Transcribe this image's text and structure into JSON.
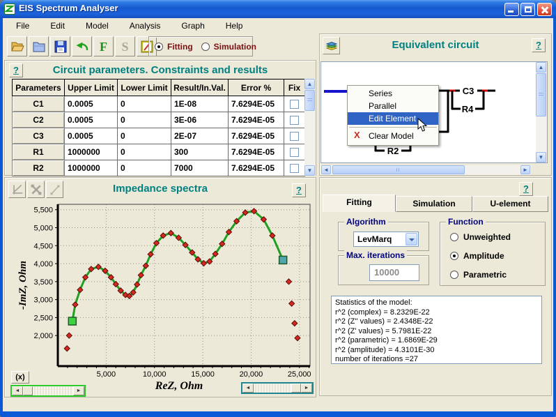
{
  "window": {
    "title": "EIS Spectrum Analyser"
  },
  "menu_bar": {
    "items": [
      "File",
      "Edit",
      "Model",
      "Analysis",
      "Graph",
      "Help"
    ]
  },
  "toolbar": {
    "icons": [
      "open-folder-icon",
      "blue-folder-icon",
      "save-icon",
      "undo-icon",
      "fit-letter",
      "simulate-letter",
      "edit-note-icon"
    ],
    "fit_letter": "F",
    "simulate_letter": "S",
    "mode": {
      "options": [
        "Fitting",
        "Simulation"
      ],
      "selected": "Fitting"
    }
  },
  "ui": {
    "help_label": "?"
  },
  "circuit_params": {
    "title": "Circuit parameters. Constraints and results",
    "table": {
      "headers": [
        "Parameters",
        "Upper Limit",
        "Lower Limit",
        "Result/In.Val.",
        "Error %",
        "Fix"
      ],
      "rows": [
        {
          "parameter": "C1",
          "upper": "0.0005",
          "lower": "0",
          "result": "1E-08",
          "error": "7.6294E-05",
          "fixed": false
        },
        {
          "parameter": "C2",
          "upper": "0.0005",
          "lower": "0",
          "result": "3E-06",
          "error": "7.6294E-05",
          "fixed": false
        },
        {
          "parameter": "C3",
          "upper": "0.0005",
          "lower": "0",
          "result": "2E-07",
          "error": "7.6294E-05",
          "fixed": false
        },
        {
          "parameter": "R1",
          "upper": "1000000",
          "lower": "0",
          "result": "300",
          "error": "7.6294E-05",
          "fixed": false
        },
        {
          "parameter": "R2",
          "upper": "1000000",
          "lower": "0",
          "result": "7000",
          "error": "7.6294E-05",
          "fixed": false
        }
      ]
    }
  },
  "equivalent_circuit": {
    "title": "Equivalent circuit",
    "elements": {
      "c3": "C3",
      "r4": "R4",
      "r2": "R2"
    },
    "context_menu": {
      "items": [
        "Series",
        "Parallel",
        "Edit Element",
        "Clear Model"
      ],
      "highlighted": "Edit Element"
    }
  },
  "impedance": {
    "title": "Impedance spectra",
    "x_button_label": "(x)"
  },
  "fitting_panel": {
    "tabs": [
      "Fitting",
      "Simulation",
      "U-element"
    ],
    "active_tab": "Fitting",
    "algorithm": {
      "label": "Algorithm",
      "value": "LevMarq"
    },
    "max_iterations": {
      "label": "Max. iterations",
      "value": "10000"
    },
    "function_group": {
      "label": "Function",
      "options": [
        "Unweighted",
        "Amplitude",
        "Parametric"
      ],
      "selected": "Amplitude"
    },
    "statistics": {
      "lines": [
        "Statistics of the model:",
        "r^2 (complex) = 8.2329E-22",
        "r^2 (Z'' values) = 2.4348E-22",
        "r^2 (Z' values) = 5.7981E-22",
        "r^2 (parametric) = 1.6869E-29",
        "r^2 (amplitude) = 4.3101E-30",
        "number of iterations =27"
      ]
    }
  },
  "colors": {
    "heading_teal": "#008080",
    "mode_red": "#7A1010",
    "group_navy": "#000080",
    "menu_highlight": "#2F63C4",
    "curve_green": "#1FA020",
    "marker_red": "#D42A1E",
    "start_square_green": "#3FD23F",
    "end_square_teal": "#4FA6AC",
    "slider_green_border": "#2CCB2C",
    "slider_teal_border": "#1E868E"
  },
  "chart_data": {
    "type": "line",
    "title": "Impedance spectra",
    "xlabel": "ReZ, Ohm",
    "ylabel": "-ImZ, Ohm",
    "xlim": [
      0,
      26100
    ],
    "ylim": [
      1150,
      5650
    ],
    "x_ticks": [
      5000,
      10000,
      15000,
      20000,
      25000
    ],
    "x_tick_labels": [
      "5,000",
      "10,000",
      "15,000",
      "20,000",
      "25,000"
    ],
    "y_ticks": [
      2000,
      2500,
      3000,
      3500,
      4000,
      4500,
      5000,
      5500
    ],
    "y_tick_labels": [
      "2,000",
      "2,500",
      "3,000",
      "3,500",
      "4,000",
      "4,500",
      "5,000",
      "5,500"
    ],
    "grid": true,
    "legend": "none",
    "series": [
      {
        "name": "fitted-curve",
        "type": "line",
        "color": "#1FA020",
        "points": [
          [
            1500,
            2400
          ],
          [
            1800,
            2860
          ],
          [
            2300,
            3270
          ],
          [
            2850,
            3620
          ],
          [
            3450,
            3850
          ],
          [
            4200,
            3910
          ],
          [
            4900,
            3800
          ],
          [
            5500,
            3620
          ],
          [
            6000,
            3430
          ],
          [
            6500,
            3250
          ],
          [
            7000,
            3130
          ],
          [
            7400,
            3100
          ],
          [
            7800,
            3200
          ],
          [
            8200,
            3420
          ],
          [
            8600,
            3680
          ],
          [
            9100,
            3940
          ],
          [
            9600,
            4260
          ],
          [
            10200,
            4570
          ],
          [
            10900,
            4780
          ],
          [
            11700,
            4850
          ],
          [
            12500,
            4720
          ],
          [
            13200,
            4520
          ],
          [
            13900,
            4310
          ],
          [
            14500,
            4120
          ],
          [
            15100,
            4010
          ],
          [
            15700,
            4060
          ],
          [
            16300,
            4270
          ],
          [
            17000,
            4550
          ],
          [
            17700,
            4880
          ],
          [
            18500,
            5180
          ],
          [
            19400,
            5420
          ],
          [
            20300,
            5460
          ],
          [
            21300,
            5230
          ],
          [
            22200,
            4780
          ],
          [
            23300,
            4100
          ]
        ]
      },
      {
        "name": "experimental-points",
        "type": "scatter",
        "marker": "diamond",
        "color": "#D42A1E",
        "points": [
          [
            950,
            1640
          ],
          [
            1170,
            2000
          ],
          [
            1800,
            2860
          ],
          [
            2300,
            3270
          ],
          [
            2850,
            3620
          ],
          [
            3450,
            3850
          ],
          [
            4200,
            3910
          ],
          [
            4900,
            3800
          ],
          [
            5500,
            3620
          ],
          [
            6000,
            3430
          ],
          [
            6500,
            3250
          ],
          [
            7000,
            3130
          ],
          [
            7400,
            3100
          ],
          [
            7800,
            3200
          ],
          [
            8200,
            3420
          ],
          [
            8600,
            3680
          ],
          [
            9100,
            3940
          ],
          [
            9600,
            4260
          ],
          [
            10200,
            4570
          ],
          [
            10900,
            4780
          ],
          [
            11700,
            4850
          ],
          [
            12500,
            4720
          ],
          [
            13200,
            4520
          ],
          [
            13900,
            4310
          ],
          [
            14500,
            4120
          ],
          [
            15100,
            4010
          ],
          [
            15700,
            4060
          ],
          [
            16300,
            4270
          ],
          [
            17000,
            4550
          ],
          [
            17700,
            4880
          ],
          [
            18500,
            5180
          ],
          [
            19400,
            5420
          ],
          [
            20300,
            5460
          ],
          [
            21300,
            5230
          ],
          [
            22200,
            4780
          ],
          [
            23900,
            3500
          ],
          [
            24200,
            2890
          ],
          [
            24500,
            2340
          ],
          [
            24800,
            1930
          ]
        ]
      },
      {
        "name": "range-start-marker",
        "type": "scatter",
        "marker": "square",
        "color": "#3FD23F",
        "points": [
          [
            1500,
            2400
          ]
        ]
      },
      {
        "name": "range-end-marker",
        "type": "scatter",
        "marker": "square",
        "color": "#4FA6AC",
        "points": [
          [
            23300,
            4100
          ]
        ]
      }
    ]
  }
}
